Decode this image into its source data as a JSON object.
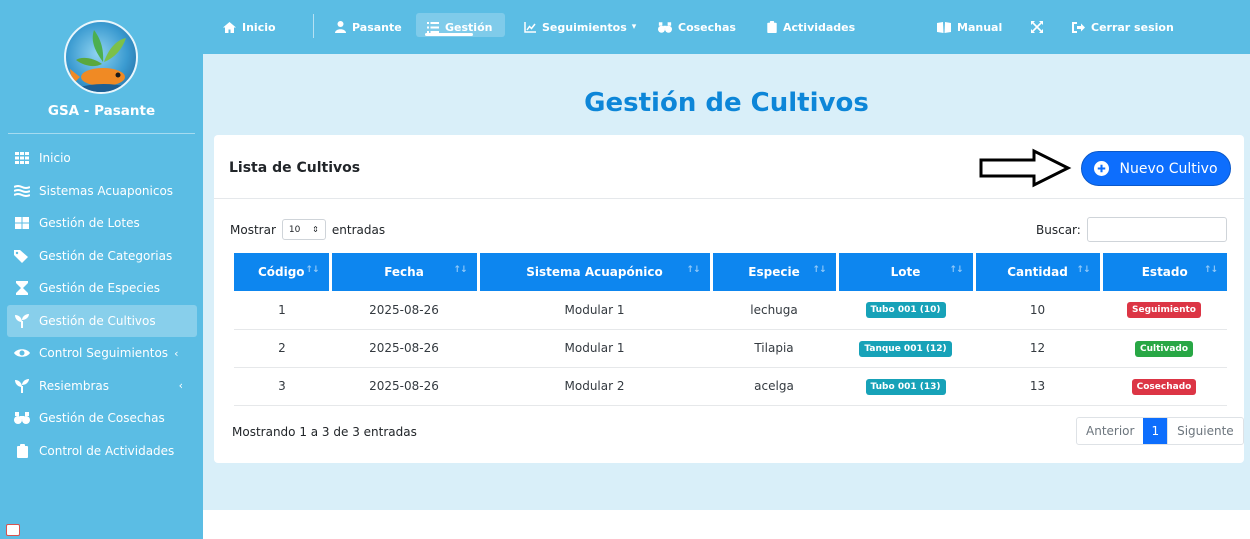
{
  "sidebar": {
    "brand": "GSA - Pasante",
    "items": [
      {
        "label": "Inicio"
      },
      {
        "label": "Sistemas Acuaponicos"
      },
      {
        "label": "Gestión de Lotes"
      },
      {
        "label": "Gestión de Categorias"
      },
      {
        "label": "Gestión de Especies"
      },
      {
        "label": "Gestión de Cultivos"
      },
      {
        "label": "Control Seguimientos",
        "caret": "‹"
      },
      {
        "label": "Resiembras",
        "caret": "‹"
      },
      {
        "label": "Gestión de Cosechas"
      },
      {
        "label": "Control de Actividades"
      }
    ]
  },
  "topnav": {
    "items": [
      {
        "label": "Inicio"
      },
      {
        "label": "Pasante"
      },
      {
        "label": "Gestión"
      },
      {
        "label": "Seguimientos",
        "caret": "▾"
      },
      {
        "label": "Cosechas"
      },
      {
        "label": "Actividades"
      },
      {
        "label": "Manual"
      },
      {
        "label": ""
      },
      {
        "label": "Cerrar sesion"
      }
    ]
  },
  "page": {
    "title": "Gestión de Cultivos"
  },
  "card": {
    "title": "Lista de Cultivos",
    "new_button": "Nuevo Cultivo"
  },
  "table": {
    "length_prefix": "Mostrar",
    "length_value": "10",
    "length_suffix": "entradas",
    "search_label": "Buscar:",
    "search_value": "",
    "columns": [
      "Código",
      "Fecha",
      "Sistema Acuapónico",
      "Especie",
      "Lote",
      "Cantidad",
      "Estado"
    ],
    "rows": [
      {
        "codigo": "1",
        "fecha": "2025-08-26",
        "sistema": "Modular 1",
        "especie": "lechuga",
        "lote": "Tubo 001 (10)",
        "cantidad": "10",
        "estado": "Seguimiento"
      },
      {
        "codigo": "2",
        "fecha": "2025-08-26",
        "sistema": "Modular 1",
        "especie": "Tilapia",
        "lote": "Tanque 001 (12)",
        "cantidad": "12",
        "estado": "Cultivado"
      },
      {
        "codigo": "3",
        "fecha": "2025-08-26",
        "sistema": "Modular 2",
        "especie": "acelga",
        "lote": "Tubo 001 (13)",
        "cantidad": "13",
        "estado": "Cosechado"
      }
    ],
    "info": "Mostrando 1 a 3 de 3 entradas",
    "pagination": {
      "prev": "Anterior",
      "current": "1",
      "next": "Siguiente"
    }
  },
  "colors": {
    "sidebar": "#5bbde4",
    "accent": "#0d86ef",
    "title": "#0d86d8",
    "badge_info": "#17a2b8",
    "badge_danger": "#dc3545",
    "badge_success": "#28a745"
  }
}
